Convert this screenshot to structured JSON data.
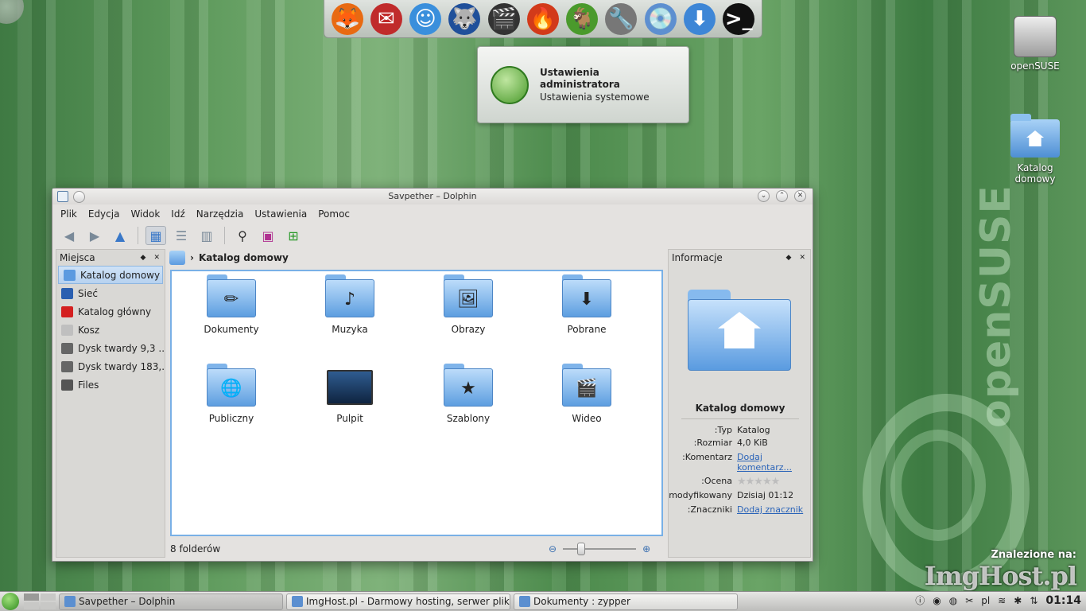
{
  "dock": {
    "items": [
      {
        "name": "firefox-icon",
        "glyph": "🦊",
        "color": "#e86a12"
      },
      {
        "name": "mail-icon",
        "glyph": "✉",
        "color": "#c02b2b"
      },
      {
        "name": "chat-icon",
        "glyph": "☺",
        "color": "#3a8fdc"
      },
      {
        "name": "kde-wolf-icon",
        "glyph": "🐺",
        "color": "#1f4f9a"
      },
      {
        "name": "video-editor-icon",
        "glyph": "🎬",
        "color": "#333333"
      },
      {
        "name": "burner-icon",
        "glyph": "🔥",
        "color": "#d23a1a"
      },
      {
        "name": "yast-icon",
        "glyph": "🐐",
        "color": "#4a9a2c"
      },
      {
        "name": "tools-icon",
        "glyph": "🔧",
        "color": "#777777"
      },
      {
        "name": "installer-icon",
        "glyph": "💿",
        "color": "#5d8fd0"
      },
      {
        "name": "download-icon",
        "glyph": "⬇",
        "color": "#3d86d6"
      },
      {
        "name": "terminal-icon",
        "glyph": ">_",
        "color": "#111111"
      }
    ]
  },
  "tooltip": {
    "title": "Ustawienia administratora",
    "subtitle": "Ustawienia systemowe"
  },
  "desktop": {
    "icons": [
      {
        "label": "openSUSE"
      },
      {
        "label": "Katalog domowy"
      }
    ],
    "brand": "openSUSE"
  },
  "window": {
    "title": "Savpether – Dolphin",
    "menu": [
      "Plik",
      "Edycja",
      "Widok",
      "Idź",
      "Narzędzia",
      "Ustawienia",
      "Pomoc"
    ],
    "places_title": "Miejsca",
    "places": [
      {
        "label": "Katalog domowy",
        "color": "#5b9ae0",
        "selected": true
      },
      {
        "label": "Sieć",
        "color": "#2a5fb0"
      },
      {
        "label": "Katalog główny",
        "color": "#d42020"
      },
      {
        "label": "Kosz",
        "color": "#bfbfbf"
      },
      {
        "label": "Dysk twardy 9,3 ...",
        "color": "#666666"
      },
      {
        "label": "Dysk twardy 183,...",
        "color": "#666666"
      },
      {
        "label": "Files",
        "color": "#555555"
      }
    ],
    "breadcrumb": "Katalog domowy",
    "items": [
      {
        "label": "Dokumenty",
        "emblem": "✏"
      },
      {
        "label": "Muzyka",
        "emblem": "♪"
      },
      {
        "label": "Obrazy",
        "emblem": "🖼"
      },
      {
        "label": "Pobrane",
        "emblem": "⬇"
      },
      {
        "label": "Publiczny",
        "emblem": "🌐"
      },
      {
        "label": "Pulpit",
        "emblem": ""
      },
      {
        "label": "Szablony",
        "emblem": "★"
      },
      {
        "label": "Wideo",
        "emblem": "🎬"
      }
    ],
    "status": "8 folderów",
    "info": {
      "title": "Informacje",
      "name": "Katalog domowy",
      "rows": [
        {
          "k": "Typ:",
          "v": "Katalog"
        },
        {
          "k": "Rozmiar:",
          "v": "4,0 KiB"
        },
        {
          "k": "Komentarz:",
          "v": "Dodaj komentarz...",
          "link": true
        },
        {
          "k": "Ocena:",
          "v": "★★★★★",
          "stars": true
        },
        {
          "k": "modyfikowany:",
          "v": "Dzisiaj 01:12"
        },
        {
          "k": "Znaczniki:",
          "v": "Dodaj znacznik",
          "link": true
        }
      ]
    }
  },
  "taskbar": {
    "tasks": [
      {
        "label": "Savpether – Dolphin",
        "active": true
      },
      {
        "label": "ImgHost.pl - Darmowy hosting, serwer plików"
      },
      {
        "label": "Dokumenty : zypper"
      }
    ],
    "lang": "pl",
    "clock": "01:14"
  },
  "watermark": {
    "line1": "Znalezione na:",
    "line2": "ImgHost.pl"
  }
}
